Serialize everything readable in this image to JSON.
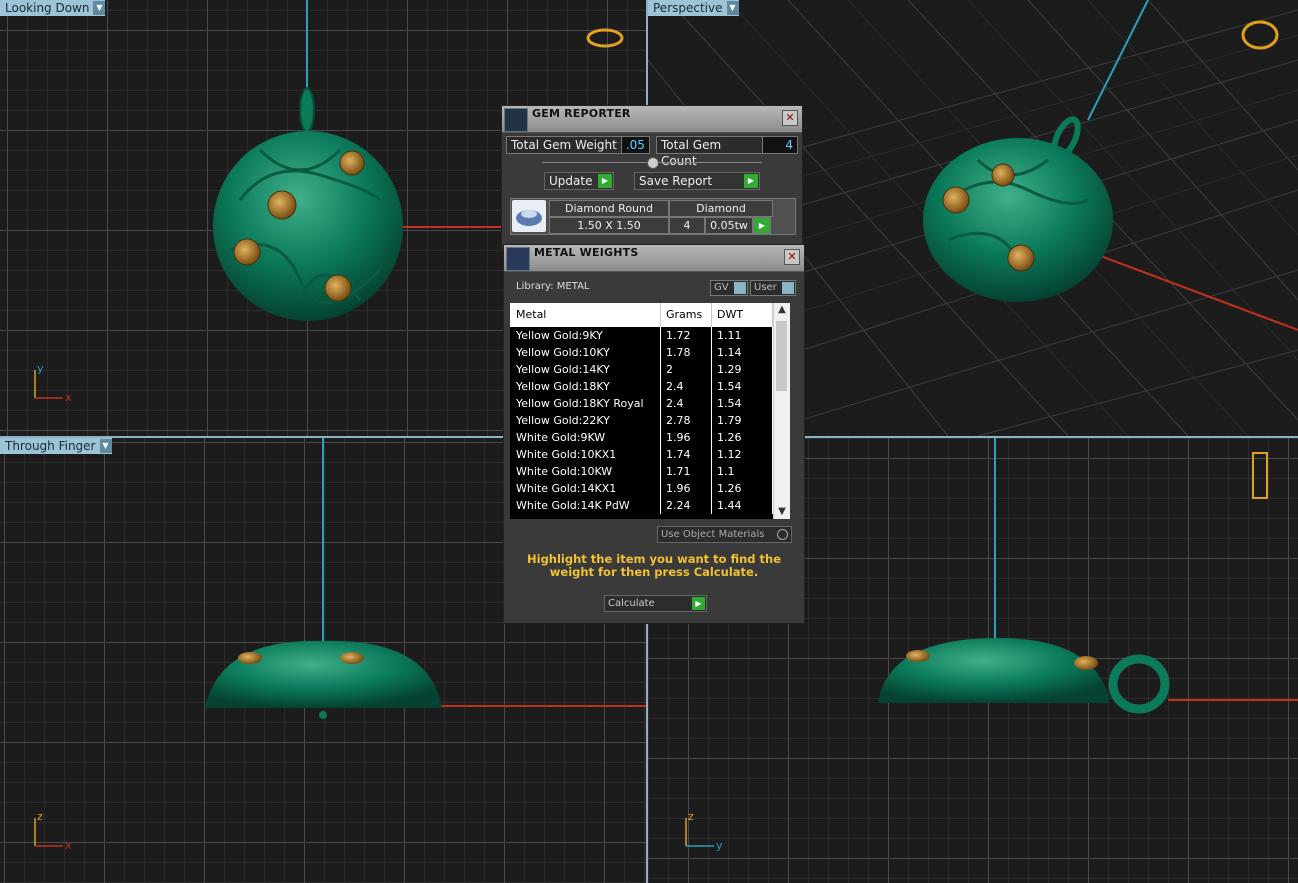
{
  "viewports": {
    "top_left": {
      "label": "Looking Down"
    },
    "top_right": {
      "label": "Perspective"
    },
    "bottom_left": {
      "label": "Through Finger"
    }
  },
  "axes": {
    "top_left": {
      "v": "y",
      "h": "x"
    },
    "bottom_left": {
      "v": "z",
      "h": "x"
    },
    "bottom_right": {
      "v": "z",
      "h": "y"
    }
  },
  "gem_reporter": {
    "title": "GEM REPORTER",
    "total_gem_weight_label": "Total Gem Weight",
    "total_gem_weight": ".05",
    "total_gem_count_label": "Total Gem Count",
    "total_gem_count": "4",
    "update_label": "Update",
    "save_report_label": "Save Report",
    "gem": {
      "shape": "Diamond Round",
      "size": "1.50 X 1.50",
      "material": "Diamond",
      "count": "4",
      "weight": "0.05tw"
    }
  },
  "metal_weights": {
    "title": "METAL WEIGHTS",
    "library_label": "Library: METAL",
    "toggle_gv": "GV",
    "toggle_user": "User",
    "columns": [
      "Metal",
      "Grams",
      "DWT"
    ],
    "rows": [
      [
        "Yellow Gold:9KY",
        "1.72",
        "1.11"
      ],
      [
        "Yellow Gold:10KY",
        "1.78",
        "1.14"
      ],
      [
        "Yellow Gold:14KY",
        "2",
        "1.29"
      ],
      [
        "Yellow Gold:18KY",
        "2.4",
        "1.54"
      ],
      [
        "Yellow Gold:18KY Royal",
        "2.4",
        "1.54"
      ],
      [
        "Yellow Gold:22KY",
        "2.78",
        "1.79"
      ],
      [
        "White Gold:9KW",
        "1.96",
        "1.26"
      ],
      [
        "White Gold:10KX1",
        "1.74",
        "1.12"
      ],
      [
        "White Gold:10KW",
        "1.71",
        "1.1"
      ],
      [
        "White Gold:14KX1",
        "1.96",
        "1.26"
      ],
      [
        "White Gold:14K PdW",
        "2.24",
        "1.44"
      ]
    ],
    "use_object_materials": "Use Object Materials",
    "hint": "Highlight the item you want to find the weight for then press Calculate.",
    "calculate_label": "Calculate"
  },
  "colors": {
    "model_green": "#0b7a5a",
    "axis_red": "#c0301e",
    "axis_cyan": "#2a9fc0",
    "hint_yellow": "#f1c232"
  }
}
